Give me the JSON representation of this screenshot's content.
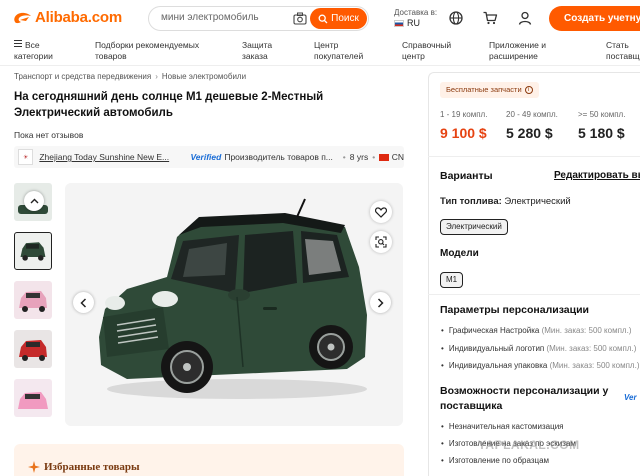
{
  "header": {
    "logo_text": "Alibaba.com",
    "search_value": "мини электромобиль",
    "search_button": "Поиск",
    "deliver_to_label": "Доставка в:",
    "country_code": "RU",
    "signup_label": "Создать учетную з",
    "accent_color": "#ff5a00"
  },
  "nav": [
    {
      "line1": "Все",
      "line2": "категории",
      "icon": "menu-icon"
    },
    {
      "line1": "Подборки рекомендуемых",
      "line2": "товаров"
    },
    {
      "line1": "Защита",
      "line2": "заказа"
    },
    {
      "line1": "Центр",
      "line2": "покупателей"
    },
    {
      "line1": "Справочный",
      "line2": "центр"
    },
    {
      "line1": "Приложение и",
      "line2": "расширение"
    },
    {
      "line1": "Стать",
      "line2": "поставщ"
    }
  ],
  "breadcrumb": [
    "Транспорт и средства передвижения",
    "Новые электромобили"
  ],
  "product": {
    "title": "На сегодняшний день солнце M1 дешевые 2-Местный Электрический автомобиль",
    "reviews": "Пока нет отзывов",
    "supplier_name": "Zhejiang Today Sunshine New E...",
    "verified": "Verified",
    "manufacturer": "Производитель товаров п...",
    "years": "8 yrs",
    "country": "CN",
    "car_color": "#2f4a38"
  },
  "featured_label": "Избранные товары",
  "pricing": {
    "promo": "Бесплатные запчасти",
    "tiers": [
      {
        "range": "1 - 19 компл.",
        "price": "9 100 $"
      },
      {
        "range": "20 - 49 компл.",
        "price": "5 280 $"
      },
      {
        "range": ">= 50 компл.",
        "price": "5 180 $"
      }
    ]
  },
  "variants": {
    "title": "Варианты",
    "edit_link": "Редактировать вы",
    "fuel_label": "Тип топлива:",
    "fuel_value": "Электрический",
    "fuel_chip": "Электрический",
    "models_label": "Модели",
    "model_chip": "M1"
  },
  "personalization": {
    "title": "Параметры персонализации",
    "items": [
      {
        "name": "Графическая Настройка",
        "min": "(Мин. заказ: 500 компл.)"
      },
      {
        "name": "Индивидуальный логотип",
        "min": "(Мин. заказ: 500 компл.)"
      },
      {
        "name": "Индивидуальная упаковка",
        "min": "(Мин. заказ: 500 компл.)"
      }
    ]
  },
  "customization": {
    "title": "Возможности персонализации у поставщика",
    "verified": "Ver",
    "items": [
      "Незначительная кастомизация",
      "Изготовление на заказ по эскизам",
      "Изготовление по образцам"
    ]
  },
  "watermark": "YAPLAKAL.COM"
}
